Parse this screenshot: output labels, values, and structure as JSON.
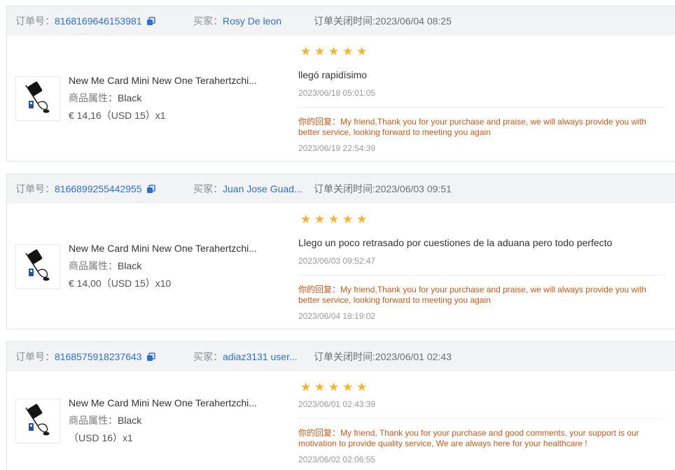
{
  "labels": {
    "order_no": "订单号：",
    "buyer": "买家：",
    "close_time": "订单关闭时间:",
    "attr": "商品属性：",
    "reply": "你的回复："
  },
  "colors": {
    "link": "#2d6fd3",
    "star": "#f7b431",
    "reply": "#c25a1c",
    "header_bg": "#f2f3f5"
  },
  "icons": {
    "copy": "copy-icon",
    "star": "star-icon",
    "product": "product-thumbnail"
  },
  "orders": [
    {
      "order_no": "8168169646153981",
      "buyer": "Rosy De leon",
      "close_time": "2023/06/04 08:25",
      "product": {
        "title": "New Me Card Mini New One Terahertzchi...",
        "attr_value": "Black",
        "price": "€ 14,16（USD 15）x1"
      },
      "rating": 5,
      "review_text": "llegó rapidísimo",
      "review_date": "2023/06/18 05:01:05",
      "reply_text": "My friend,Thank you for your purchase and praise, we will always provide you with better service, looking forward to meeting you again",
      "reply_date": "2023/06/19 22:54:39"
    },
    {
      "order_no": "8166899255442955",
      "buyer": "Juan Jose Guad...",
      "close_time": "2023/06/03 09:51",
      "product": {
        "title": "New Me Card Mini New One Terahertzchi...",
        "attr_value": "Black",
        "price": "€ 14,00（USD 15）x10"
      },
      "rating": 5,
      "review_text": "Llego un poco retrasado por cuestiones de la aduana pero todo perfecto",
      "review_date": "2023/06/03 09:52:47",
      "reply_text": "My friend,Thank you for your purchase and praise, we will always provide you with better service, looking forward to meeting you again",
      "reply_date": "2023/06/04 18:19:02"
    },
    {
      "order_no": "8168575918237643",
      "buyer": "adiaz3131 user...",
      "close_time": "2023/06/01 02:43",
      "product": {
        "title": "New Me Card Mini New One Terahertzchi...",
        "attr_value": "Black",
        "price": "（USD 16）x1"
      },
      "rating": 5,
      "review_date": "2023/06/01 02:43:39",
      "reply_text": "My friend, Thank you for your purchase and good comments, your support is our motivation to provide quality service, We are always here for your healthcare !",
      "reply_date": "2023/06/02 02:06:55"
    }
  ]
}
